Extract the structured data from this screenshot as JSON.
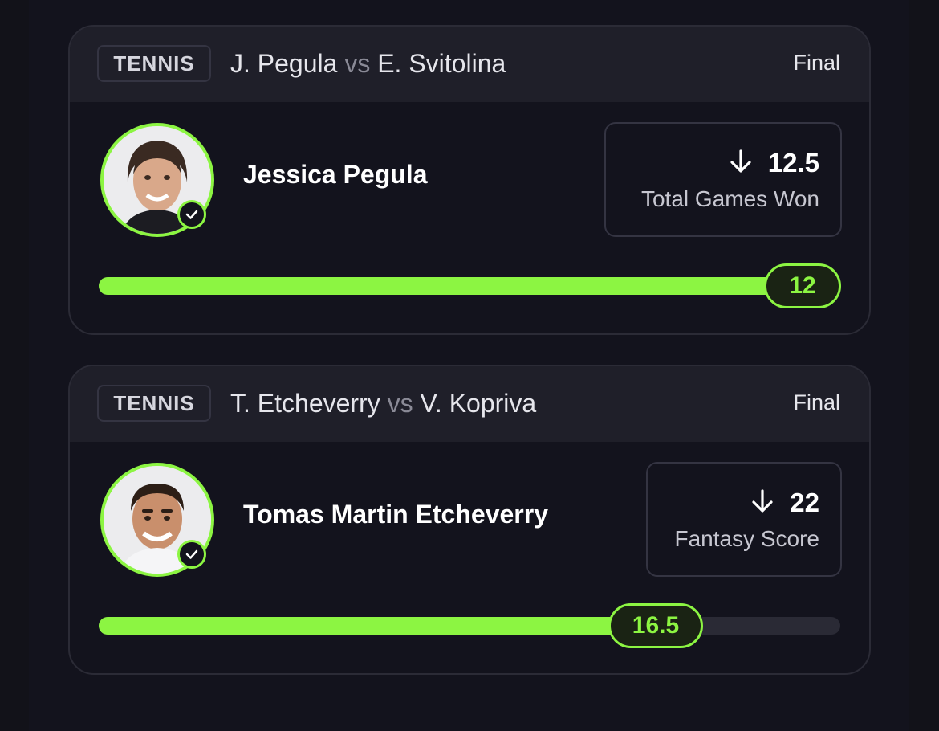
{
  "cards": [
    {
      "sport": "TENNIS",
      "player_a": "J. Pegula",
      "vs": "vs",
      "player_b": "E. Svitolina",
      "status": "Final",
      "player_name": "Jessica Pegula",
      "direction_icon": "arrow-down-icon",
      "line": "12.5",
      "stat": "Total Games Won",
      "result": "12",
      "progress_fraction": 1.0
    },
    {
      "sport": "TENNIS",
      "player_a": "T. Etcheverry",
      "vs": "vs",
      "player_b": "V. Kopriva",
      "status": "Final",
      "player_name": "Tomas Martin Etcheverry",
      "direction_icon": "arrow-down-icon",
      "line": "22",
      "stat": "Fantasy Score",
      "result": "16.5",
      "progress_fraction": 0.75
    }
  ],
  "colors": {
    "accent": "#8cf542",
    "background": "#13131d",
    "header": "#1f1f29"
  }
}
